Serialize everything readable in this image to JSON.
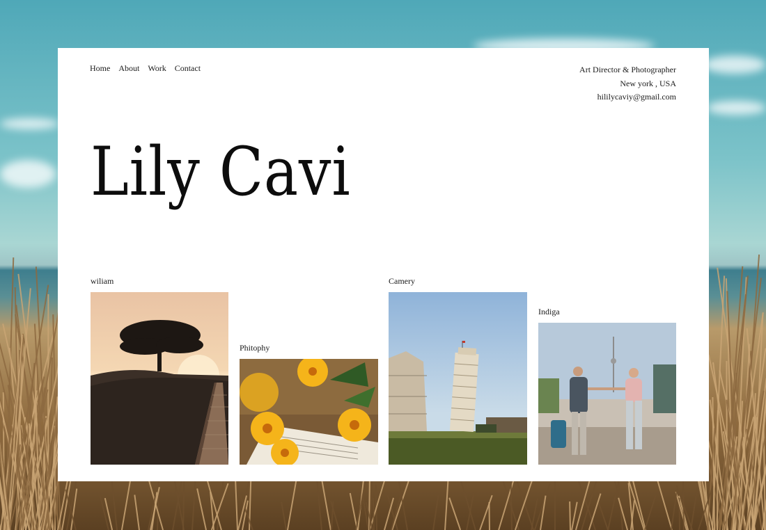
{
  "nav": {
    "items": [
      {
        "label": "Home"
      },
      {
        "label": "About"
      },
      {
        "label": "Work"
      },
      {
        "label": "Contact"
      }
    ]
  },
  "info": {
    "role": "Art Director & Photographer",
    "location": "New york , USA",
    "email": "hililycaviy@gmail.com"
  },
  "hero": {
    "name": "Lily Cavi"
  },
  "gallery": [
    {
      "caption": "wiliam",
      "image": "sunset-tree-boardwalk"
    },
    {
      "caption": "Phitophy",
      "image": "yellow-flowers-book"
    },
    {
      "caption": "Camery",
      "image": "leaning-tower-pisa"
    },
    {
      "caption": "Indiga",
      "image": "couple-holding-hands"
    }
  ],
  "colors": {
    "card": "#ffffff",
    "text": "#1a1a1a"
  }
}
